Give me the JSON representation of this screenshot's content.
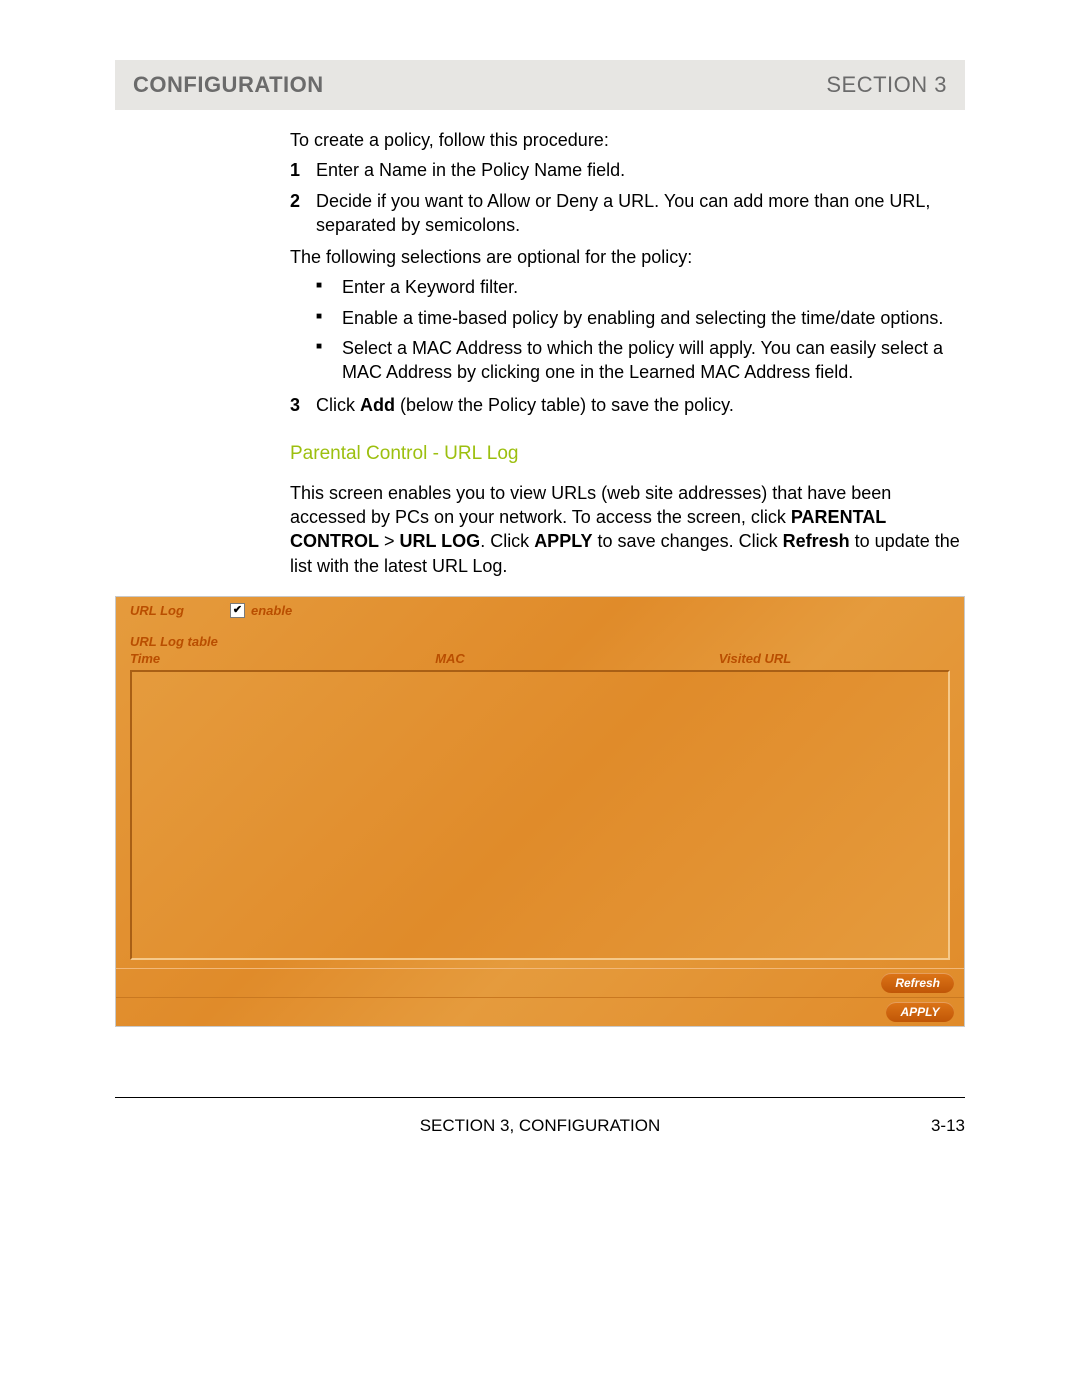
{
  "header": {
    "left": "CONFIGURATION",
    "right": "SECTION 3"
  },
  "intro": "To create a policy, follow this procedure:",
  "steps": [
    {
      "n": "1",
      "text": "Enter a Name in the Policy Name field."
    },
    {
      "n": "2",
      "text": "Decide if you want to Allow or Deny a URL. You can add more than one URL, separated by semicolons."
    }
  ],
  "optionalIntro": "The following selections are optional for the policy:",
  "bullets": [
    "Enter a Keyword filter.",
    "Enable a time-based policy by enabling and selecting the time/date options.",
    "Select a MAC Address to which the policy will apply. You can easily select a MAC Address by clicking one in the Learned MAC Address field."
  ],
  "step3": {
    "n": "3",
    "pre": "Click ",
    "bold": "Add",
    "post": " (below the Policy table) to save the policy."
  },
  "sectionHeading": "Parental Control - URL Log",
  "paragraph": {
    "p1": "This screen enables you to view URLs (web site addresses) that have been accessed by PCs on your network. To access the screen, click ",
    "b1": "PARENTAL CONTROL",
    "gt": " > ",
    "b2": "URL LOG",
    "p2": ". Click ",
    "b3": "APPLY",
    "p3": " to save changes. Click ",
    "b4": "Refresh",
    "p4": " to update the list with the latest URL Log."
  },
  "ui": {
    "urlLogLabel": "URL Log",
    "enableChecked": true,
    "enableLabel": "enable",
    "tableTitle": "URL Log table",
    "cols": {
      "time": "Time",
      "mac": "MAC",
      "url": "Visited URL"
    },
    "refresh": "Refresh",
    "apply": "APPLY"
  },
  "footer": {
    "center": "SECTION 3, CONFIGURATION",
    "right": "3-13"
  }
}
